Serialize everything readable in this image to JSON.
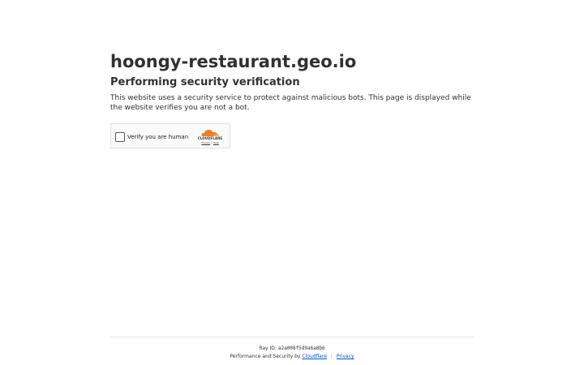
{
  "header": {
    "site_title": "hoongy-restaurant.geo.io",
    "subtitle": "Performing security verification",
    "description": "This website uses a security service to protect against malicious bots. This page is displayed while the website verifies you are not a bot."
  },
  "widget": {
    "checkbox_label": "Verify you are human",
    "brand": "CLOUDFLARE",
    "privacy_link": "Privacy",
    "link_separator": "•",
    "help_link": "Help",
    "checked": false
  },
  "footer": {
    "ray_label": "Ray ID:",
    "ray_id": "a2a008f5d9a6a8b6",
    "perf_text": "Performance and Security by",
    "cloudflare_link": "Cloudflare",
    "separator": "|",
    "privacy_link": "Privacy"
  },
  "colors": {
    "text": "#313131",
    "link": "#0051c3",
    "cloudflare_orange": "#f38020",
    "cloudflare_orange_light": "#faae40"
  }
}
